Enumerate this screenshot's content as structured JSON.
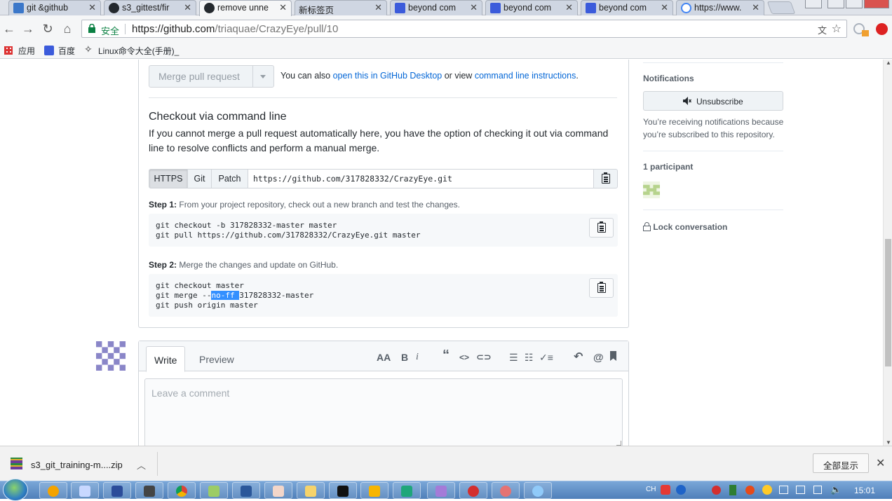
{
  "browser": {
    "tabs": [
      {
        "label": "git &github",
        "color": "#3b77c9"
      },
      {
        "label": "s3_gittest/fir",
        "color": "#24292e"
      },
      {
        "label": "remove unne",
        "color": "#24292e",
        "active": true
      },
      {
        "label": "新标签页",
        "color": ""
      },
      {
        "label": "beyond com",
        "color": "#3b5bdb"
      },
      {
        "label": "beyond com",
        "color": "#3b5bdb"
      },
      {
        "label": "beyond com",
        "color": "#3b5bdb"
      },
      {
        "label": "https://www.",
        "color": "#4285f4"
      }
    ],
    "secure_label": "安全",
    "url_host": "https://github.com",
    "url_path": "/triaquae/CrazyEye/pull/10",
    "bookmarks": [
      "应用",
      "百度",
      "Linux命令大全(手册)_"
    ]
  },
  "merge": {
    "button_label": "Merge pull request",
    "also_prefix": "You can also",
    "desktop_link": "open this in GitHub Desktop",
    "or_view": "or view",
    "cli_link": "command line instructions",
    "period": "."
  },
  "checkout": {
    "title": "Checkout via command line",
    "description": "If you cannot merge a pull request automatically here, you have the option of checking it out via command line to resolve conflicts and perform a manual merge.",
    "protocols": [
      "HTTPS",
      "Git",
      "Patch"
    ],
    "clone_url": "https://github.com/317828332/CrazyEye.git",
    "step1_label": "Step 1:",
    "step1_text": "From your project repository, check out a new branch and test the changes.",
    "step1_code": [
      "git checkout -b 317828332-master master",
      "git pull https://github.com/317828332/CrazyEye.git master"
    ],
    "step2_label": "Step 2:",
    "step2_text": "Merge the changes and update on GitHub.",
    "step2_code_line1": "git checkout master",
    "step2_code_line2_pre": "git merge --",
    "step2_code_line2_sel": "no-ff ",
    "step2_code_line2_post": "317828332-master",
    "step2_code_line3": "git push origin master"
  },
  "comment": {
    "tabs": [
      "Write",
      "Preview"
    ],
    "placeholder": "Leave a comment",
    "toolbar": [
      "AA",
      "B",
      "i",
      "“",
      "<>",
      "link",
      "ul",
      "ol",
      "tasks",
      "reply",
      "@",
      "bookmark"
    ]
  },
  "sidebar": {
    "notifications_heading": "Notifications",
    "unsubscribe_label": "Unsubscribe",
    "note": "You’re receiving notifications because you’re subscribed to this repository.",
    "participants_heading": "1 participant",
    "lock_label": "Lock conversation"
  },
  "download": {
    "filename": "s3_git_training-m....zip",
    "show_all": "全部显示"
  },
  "taskbar": {
    "lang": "CH",
    "time": "15:01"
  }
}
